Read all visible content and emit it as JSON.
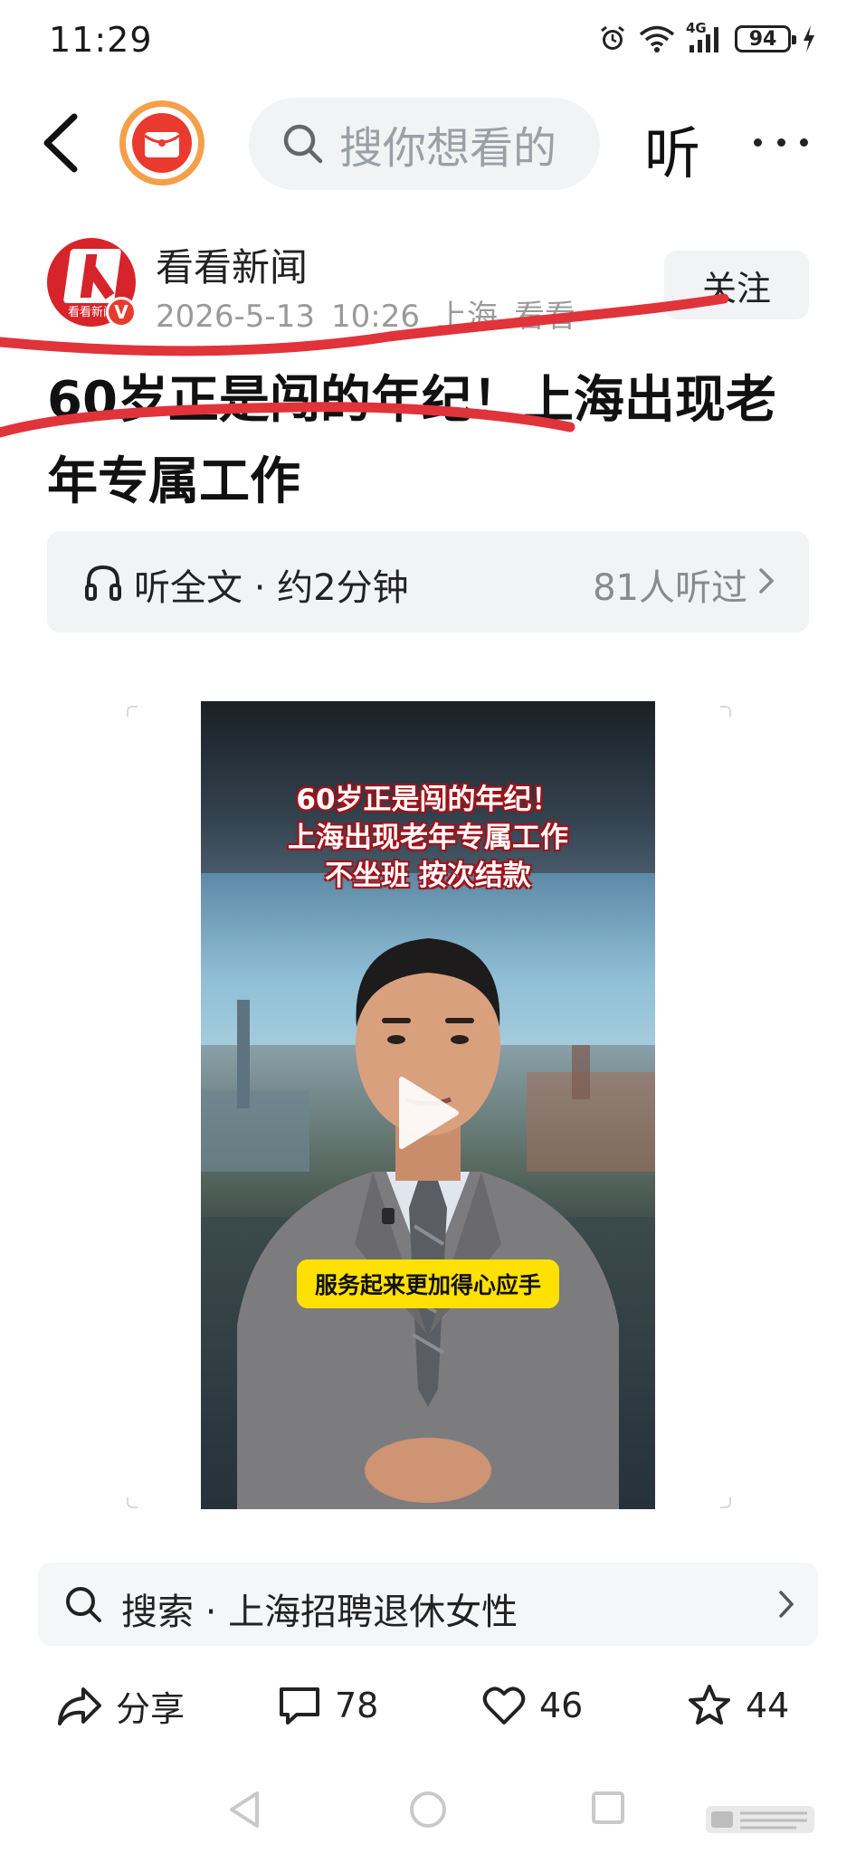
{
  "status_bar": {
    "time": "11:29",
    "network": "4G",
    "battery": "94"
  },
  "top_nav": {
    "search_placeholder": "搜你想看的",
    "listen_label": "听"
  },
  "author": {
    "name": "看看新闻",
    "avatar_caption": "看看新闻",
    "verified_mark": "V",
    "date": "2026-5-13",
    "time": "10:26",
    "location": "上海",
    "source": "看看",
    "follow_label": "关注"
  },
  "article": {
    "headline": "60岁正是闯的年纪！上海出现老年专属工作"
  },
  "listen_bar": {
    "label": "听全文 · 约2分钟",
    "count": "81人听过"
  },
  "video": {
    "caption_line1": "60岁正是闯的年纪！",
    "caption_line2": "上海出现老年专属工作",
    "caption_line3": "不坐班 按次结款",
    "subtitle": "服务起来更加得心应手"
  },
  "related_search": {
    "label": "搜索 · 上海招聘退休女性"
  },
  "actions": {
    "share_label": "分享",
    "comment_count": "78",
    "like_count": "46",
    "favorite_count": "44"
  },
  "colors": {
    "accent_red": "#ea3a2f",
    "annotation_red": "#e0343a",
    "subtitle_yellow": "#ffe100"
  }
}
